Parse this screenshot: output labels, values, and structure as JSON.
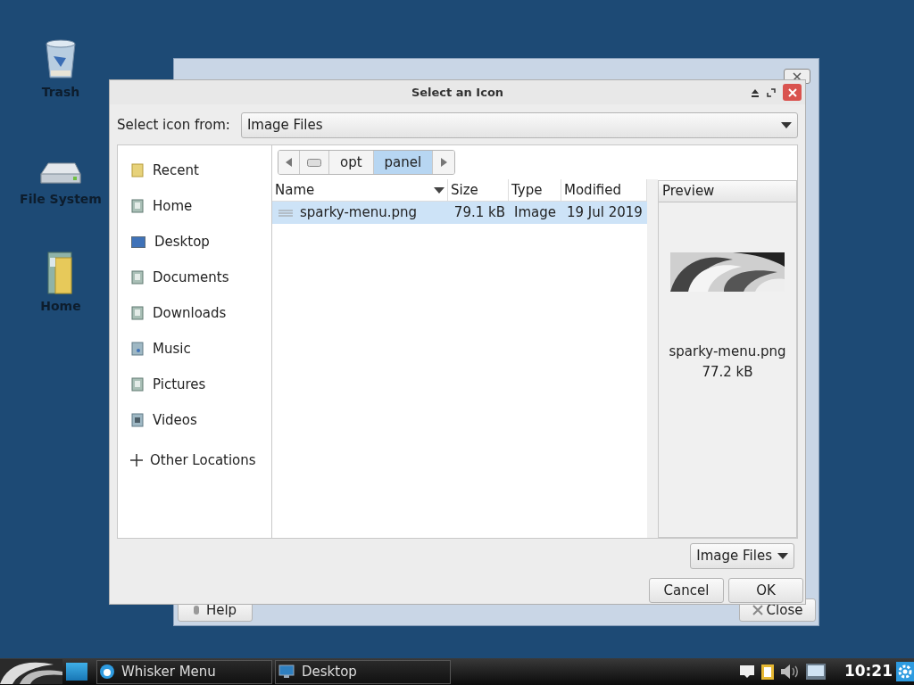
{
  "desktop_icons": [
    {
      "label": "Trash",
      "kind": "trash"
    },
    {
      "label": "File System",
      "kind": "drive"
    },
    {
      "label": "Home",
      "kind": "home"
    }
  ],
  "background_window": {
    "help_button": "Help",
    "close_button": "Close"
  },
  "dialog": {
    "title": "Select an Icon",
    "source_label": "Select icon from:",
    "source_value": "Image Files",
    "places": [
      {
        "label": "Recent",
        "kind": "recent"
      },
      {
        "label": "Home",
        "kind": "home"
      },
      {
        "label": "Desktop",
        "kind": "desktop"
      },
      {
        "label": "Documents",
        "kind": "documents"
      },
      {
        "label": "Downloads",
        "kind": "downloads"
      },
      {
        "label": "Music",
        "kind": "music"
      },
      {
        "label": "Pictures",
        "kind": "pictures"
      },
      {
        "label": "Videos",
        "kind": "videos"
      }
    ],
    "other_locations": "Other Locations",
    "path": [
      {
        "kind": "drive",
        "selected": false
      },
      {
        "kind": "folder",
        "label": "opt",
        "selected": false
      },
      {
        "kind": "folder",
        "label": "panel",
        "selected": true
      }
    ],
    "columns": [
      "Name",
      "Size",
      "Type",
      "Modified"
    ],
    "rows": [
      {
        "name": "sparky-menu.png",
        "size": "79.1 kB",
        "type": "Image",
        "modified": "19 Jul 2019",
        "selected": true
      }
    ],
    "preview": {
      "title": "Preview",
      "filename": "sparky-menu.png",
      "size": "77.2 kB"
    },
    "filter": "Image Files",
    "cancel": "Cancel",
    "ok": "OK"
  },
  "taskbar": {
    "tasks": [
      {
        "label": "Whisker Menu",
        "kind": "whisker"
      },
      {
        "label": "Desktop",
        "kind": "desktop"
      }
    ],
    "clock": "10:21"
  }
}
